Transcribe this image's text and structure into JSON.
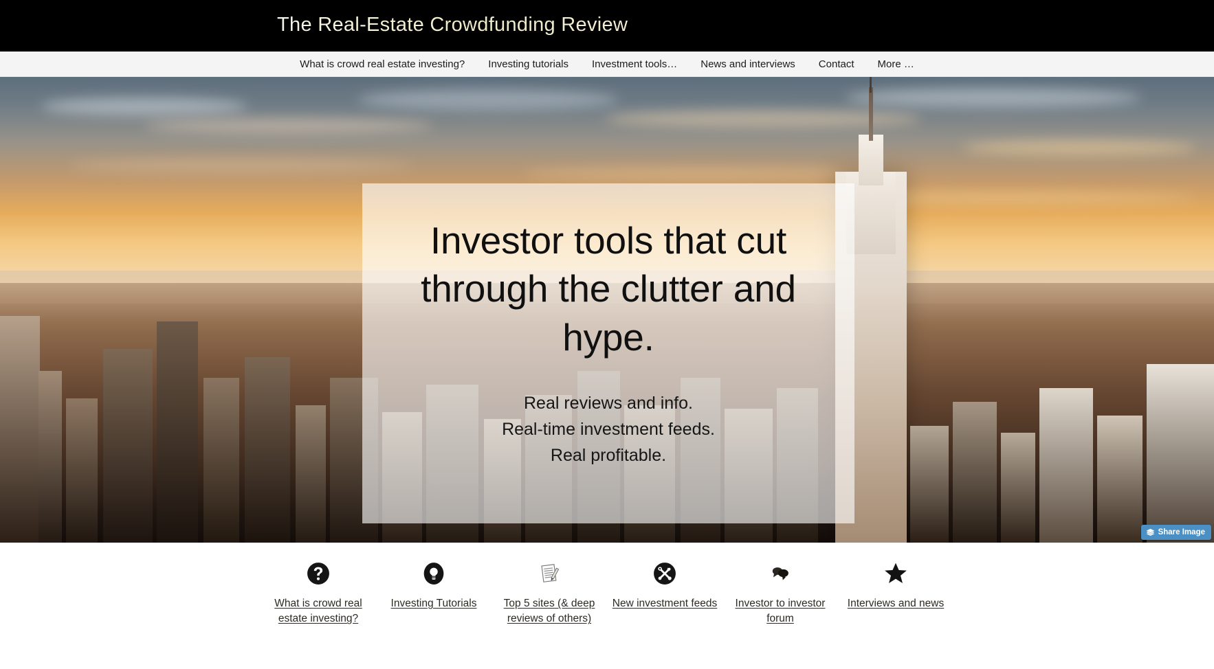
{
  "masthead": {
    "site_title": "The Real-Estate Crowdfunding Review",
    "background_color": "#000000",
    "title_color": "#f2efd2"
  },
  "nav": {
    "background_color": "#f4f4f4",
    "items": [
      {
        "label": "What is crowd real estate investing?"
      },
      {
        "label": "Investing tutorials"
      },
      {
        "label": "Investment tools…"
      },
      {
        "label": "News and interviews"
      },
      {
        "label": "Contact"
      },
      {
        "label": "More …"
      }
    ]
  },
  "hero": {
    "heading": "Investor tools that cut through the clutter and hype.",
    "sub_lines": [
      "Real reviews and info.",
      "Real-time investment feeds.",
      "Real profitable."
    ],
    "overlay_color": "rgba(255,255,255,0.62)",
    "share_button": {
      "label": "Share Image",
      "icon": "layers-icon",
      "background_color": "#4a90c4",
      "text_color": "#ffffff"
    }
  },
  "tiles": [
    {
      "icon": "question-mark-circle-icon",
      "label": "What is crowd real estate investing?"
    },
    {
      "icon": "lightbulb-circle-icon",
      "label": "Investing Tutorials"
    },
    {
      "icon": "notepad-pencil-icon",
      "label": "Top 5 sites (& deep reviews of others)"
    },
    {
      "icon": "tools-circle-icon",
      "label": "New investment feeds"
    },
    {
      "icon": "speech-bubbles-icon",
      "label": "Investor to investor forum"
    },
    {
      "icon": "star-icon",
      "label": "Interviews and news"
    }
  ]
}
